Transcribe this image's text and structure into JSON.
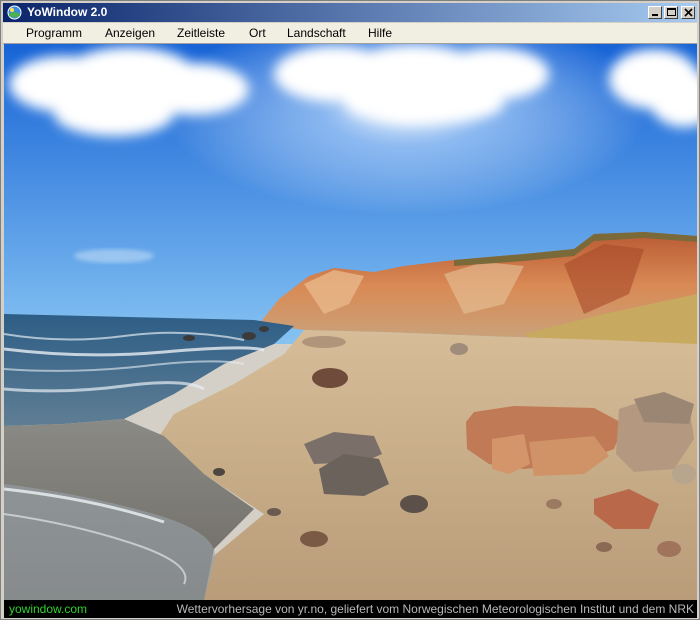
{
  "window": {
    "title": "YoWindow 2.0",
    "app_icon": "yowindow-globe-icon",
    "controls": [
      "minimize-icon",
      "maximize-icon",
      "close-icon"
    ]
  },
  "menu": {
    "items": [
      {
        "label": "Programm"
      },
      {
        "label": "Anzeigen"
      },
      {
        "label": "Zeitleiste"
      },
      {
        "label": "Ort"
      },
      {
        "label": "Landschaft"
      },
      {
        "label": "Hilfe"
      }
    ]
  },
  "scene": {
    "description_tag": "landscape-view",
    "colors": {
      "sky_top": "#1a6fd9",
      "sky_bottom": "#7fbdf0",
      "sea": "#3f6f95",
      "sand": "#c9ad8a",
      "cliff": "#c8653a",
      "grass": "#c7a960"
    }
  },
  "status": {
    "left": "yowindow.com",
    "right": "Wettervorhersage von yr.no, geliefert vom Norwegischen Meteorologischen Institut und dem NRK",
    "left_color": "#2fd12f",
    "background": "#000000"
  }
}
